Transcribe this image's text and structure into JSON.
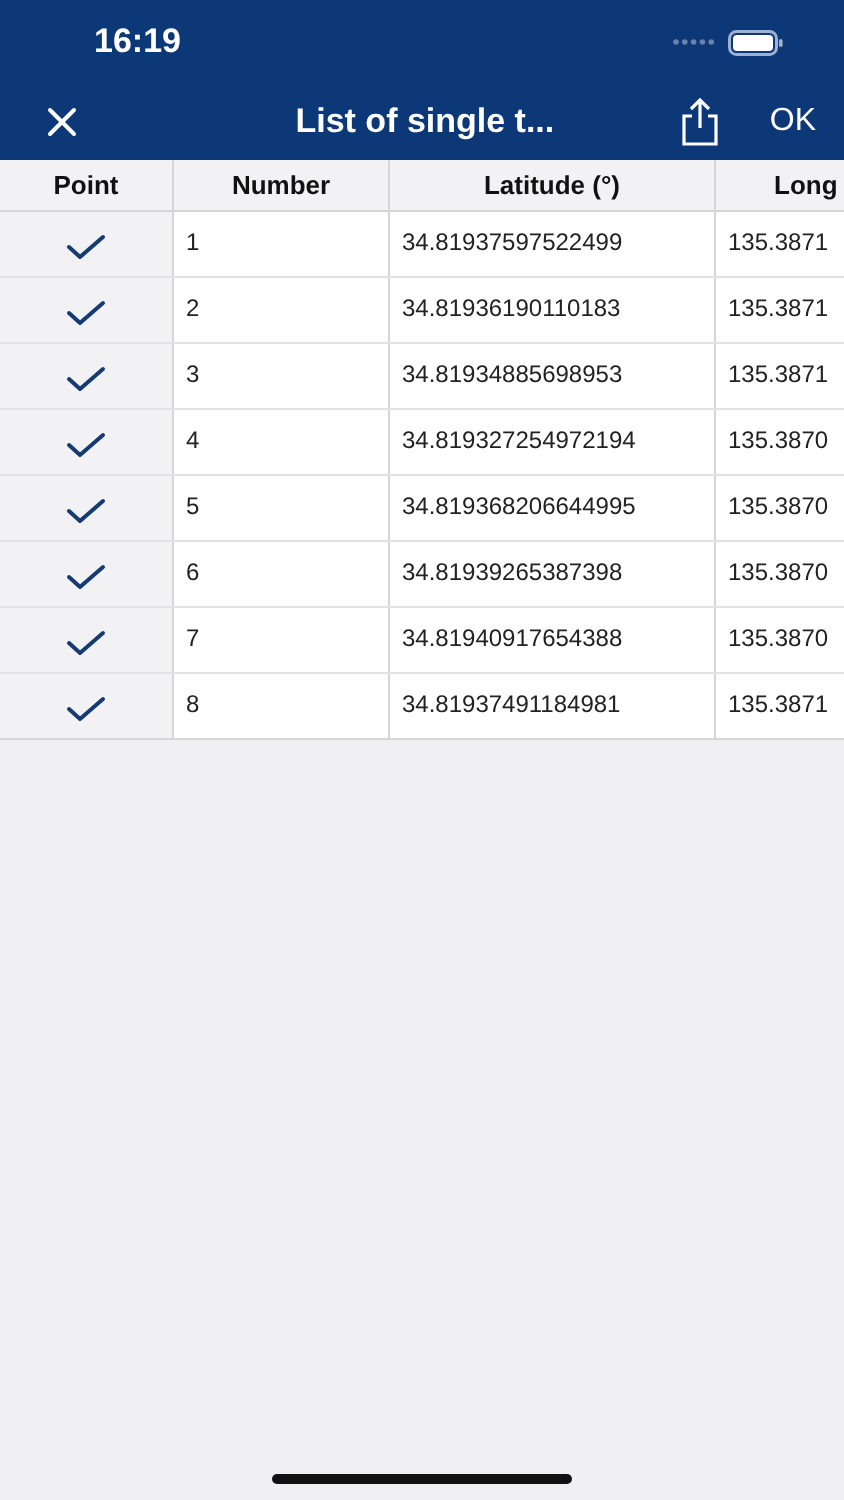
{
  "status_bar": {
    "time": "16:19"
  },
  "nav": {
    "title": "List of single t...",
    "confirm": "OK"
  },
  "table": {
    "columns": [
      "Point",
      "Number",
      "Latitude (°)",
      "Long"
    ],
    "rows": [
      {
        "checked": true,
        "number": "1",
        "latitude": "34.81937597522499",
        "column_4": "135.3871"
      },
      {
        "checked": true,
        "number": "2",
        "latitude": "34.81936190110183",
        "column_4": "135.3871"
      },
      {
        "checked": true,
        "number": "3",
        "latitude": "34.81934885698953",
        "column_4": "135.3871"
      },
      {
        "checked": true,
        "number": "4",
        "latitude": "34.819327254972194",
        "column_4": "135.3870"
      },
      {
        "checked": true,
        "number": "5",
        "latitude": "34.819368206644995",
        "column_4": "135.3870"
      },
      {
        "checked": true,
        "number": "6",
        "latitude": "34.81939265387398",
        "column_4": "135.3870"
      },
      {
        "checked": true,
        "number": "7",
        "latitude": "34.81940917654388",
        "column_4": "135.3870"
      },
      {
        "checked": true,
        "number": "8",
        "latitude": "34.81937491184981",
        "column_4": "135.3871"
      }
    ]
  }
}
